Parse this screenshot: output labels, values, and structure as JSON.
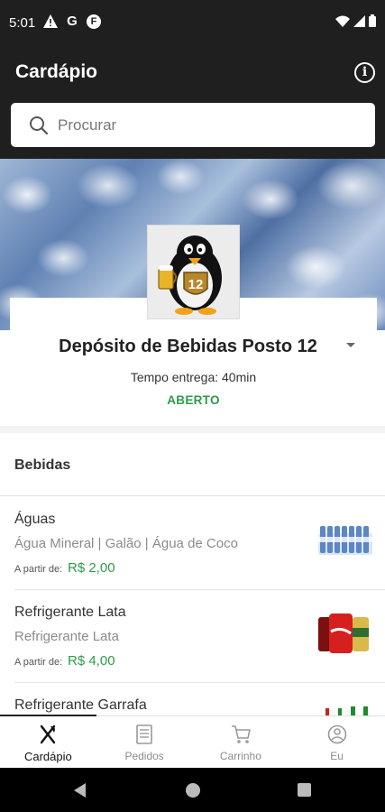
{
  "status_bar": {
    "time": "5:01",
    "icons": [
      "warning-icon",
      "google-icon",
      "flipboard-icon",
      "wifi-icon",
      "signal-icon",
      "battery-icon"
    ]
  },
  "app_bar": {
    "title": "Cardápio",
    "info_icon": "info-icon"
  },
  "search": {
    "placeholder": "Procurar"
  },
  "store": {
    "name": "Depósito de Bebidas Posto 12",
    "delivery_time": "Tempo entrega: 40min",
    "status": "ABERTO",
    "badge_number": "12"
  },
  "category": {
    "title": "Bebidas"
  },
  "items": [
    {
      "name": "Águas",
      "description": "Água Mineral | Galão | Água de Coco",
      "from_label": "A partir de:",
      "price": "R$ 2,00"
    },
    {
      "name": "Refrigerante Lata",
      "description": "Refrigerante Lata",
      "from_label": "A partir de:",
      "price": "R$ 4,00"
    },
    {
      "name": "Refrigerante Garrafa"
    }
  ],
  "bottom_nav": [
    {
      "label": "Cardápio",
      "icon": "cutlery-icon",
      "active": true
    },
    {
      "label": "Pedidos",
      "icon": "receipt-icon",
      "active": false
    },
    {
      "label": "Carrinho",
      "icon": "cart-icon",
      "active": false
    },
    {
      "label": "Eu",
      "icon": "user-icon",
      "active": false
    }
  ],
  "colors": {
    "dark_bar": "#1f1f1f",
    "accent_green": "#2e9a4a",
    "price_green": "#2e9a4a"
  }
}
